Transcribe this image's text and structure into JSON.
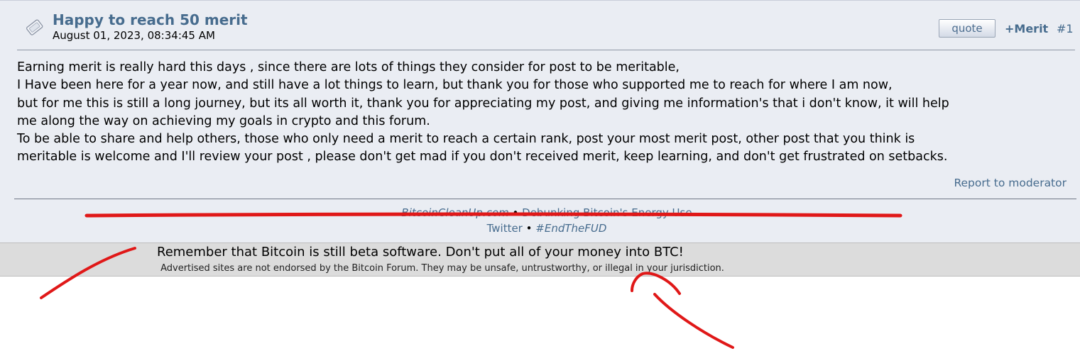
{
  "post": {
    "title": "Happy to reach 50 merit",
    "date": "August 01, 2023, 08:34:45 AM",
    "quote_label": "quote",
    "merit_label": "+Merit",
    "number": "#1",
    "lines": [
      "Earning merit is really hard this days , since there are lots of things they consider for post to be meritable,",
      "I Have been here for a year now, and still have a lot things to learn, but thank you for those who supported me to reach for where I am now,",
      "but for me this is still a long journey, but its all worth it, thank you for appreciating my post, and giving me information's that i don't know, it will help",
      "me along the way on achieving my goals in crypto and this forum.",
      "To be able to share and help others, those who only need a merit to reach a certain rank, post your most merit post, other post that you think is",
      "meritable is welcome and I'll review your post , please don't get mad if you don't received merit, keep learning, and don't get frustrated on setbacks."
    ],
    "report_label": "Report to moderator"
  },
  "signature": {
    "link1": "BitcoinCleanUp.com",
    "bullet": "•",
    "link2": "Debunking Bitcoin's Energy Use",
    "link3": "Twitter",
    "link4": "#EndTheFUD"
  },
  "ad": {
    "text": "Remember that Bitcoin is still beta software. Don't put all of your money into BTC!",
    "disclaimer": "Advertised sites are not endorsed by the Bitcoin Forum. They may be unsafe, untrustworthy, or illegal in your jurisdiction."
  },
  "colors": {
    "link": "#476c8e",
    "post_bg": "#eaedf3",
    "ad_bg": "#dcdcdc",
    "annotation": "#e01818"
  }
}
